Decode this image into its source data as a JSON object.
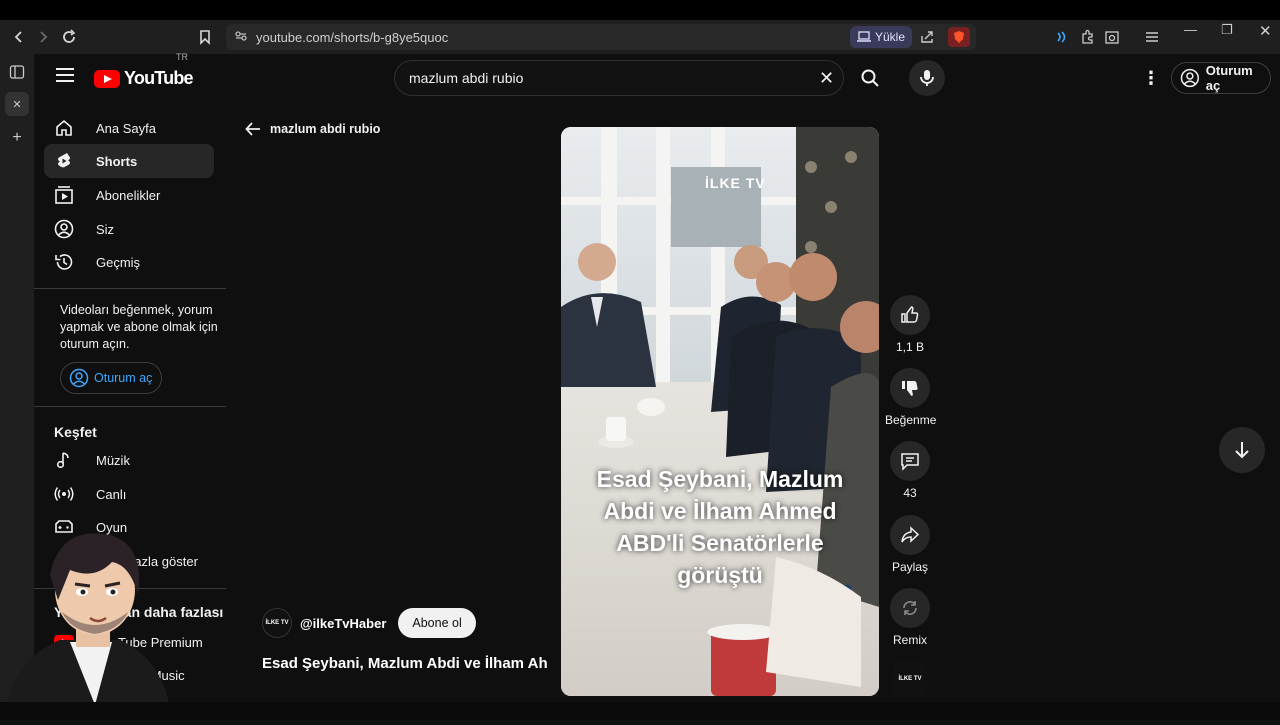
{
  "browser": {
    "url": "youtube.com/shorts/b-g8ye5quoc",
    "upload_label": "Yükle"
  },
  "masthead": {
    "logo_text": "YouTube",
    "country_code": "TR",
    "search_value": "mazlum abdi rubio",
    "signin_label": "Oturum aç"
  },
  "sidebar": {
    "items": [
      {
        "label": "Ana Sayfa",
        "icon": "home-icon"
      },
      {
        "label": "Shorts",
        "icon": "shorts-icon"
      },
      {
        "label": "Abonelikler",
        "icon": "subscriptions-icon"
      },
      {
        "label": "Siz",
        "icon": "you-icon"
      },
      {
        "label": "Geçmiş",
        "icon": "history-icon"
      }
    ],
    "signin_note": "Videoları beğenmek, yorum yapmak ve abone olmak için oturum açın.",
    "signin_label": "Oturum aç",
    "explore_heading": "Keşfet",
    "explore_items": [
      {
        "label": "Müzik",
        "icon": "music-icon"
      },
      {
        "label": "Canlı",
        "icon": "live-icon"
      },
      {
        "label": "Oyun",
        "icon": "gaming-icon"
      },
      {
        "label": "Daha fazla göster",
        "icon": "chevron-down-icon"
      }
    ],
    "more_heading": "YouTube'dan daha fazlası",
    "more_items": [
      {
        "label": "YouTube Premium"
      },
      {
        "label": "YouTube Music"
      }
    ]
  },
  "main": {
    "back_label": "mazlum abdi rubio",
    "video_overlay_text": "Esad Şeybani, Mazlum Abdi ve İlham Ahmed ABD'li Senatörlerle görüştü",
    "watermark": "İLKE TV",
    "channel_name": "@ilkeTvHaber",
    "channel_avatar_text": "İLKE TV",
    "subscribe_label": "Abone ol",
    "video_title": "Esad Şeybani, Mazlum Abdi ve İlham Ahmed ABD'li Senatörlerle görüştü"
  },
  "actions": {
    "like_count": "1,1 B",
    "dislike_label": "Beğenme",
    "comment_count": "43",
    "share_label": "Paylaş",
    "remix_label": "Remix"
  },
  "colors": {
    "background": "#0f0f0f",
    "brand_red": "#ff0000",
    "link_blue": "#3ea6ff"
  }
}
